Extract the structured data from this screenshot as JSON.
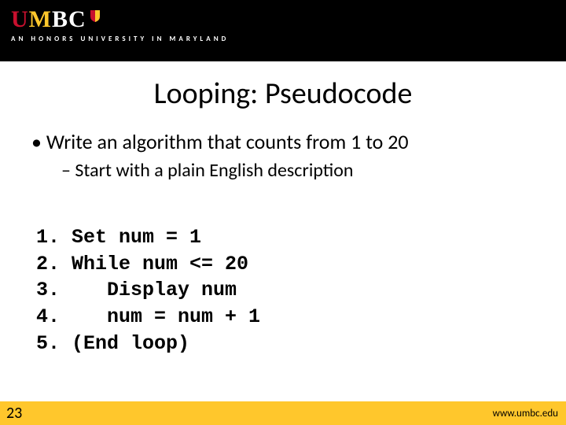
{
  "header": {
    "logo_letters": [
      "U",
      "M",
      "B",
      "C"
    ],
    "tagline": "AN HONORS UNIVERSITY IN MARYLAND"
  },
  "title": "Looping: Pseudocode",
  "bullets": {
    "main": "Write an algorithm that counts from 1 to 20",
    "sub": "Start with a plain English description"
  },
  "pseudocode": {
    "line1": "1. Set num = 1",
    "line2": "2. While num <= 20",
    "line3": "3.    Display num",
    "line4": "4.    num = num + 1",
    "line5": "5. (End loop)"
  },
  "footer": {
    "page": "23",
    "url": "www.umbc.edu"
  }
}
